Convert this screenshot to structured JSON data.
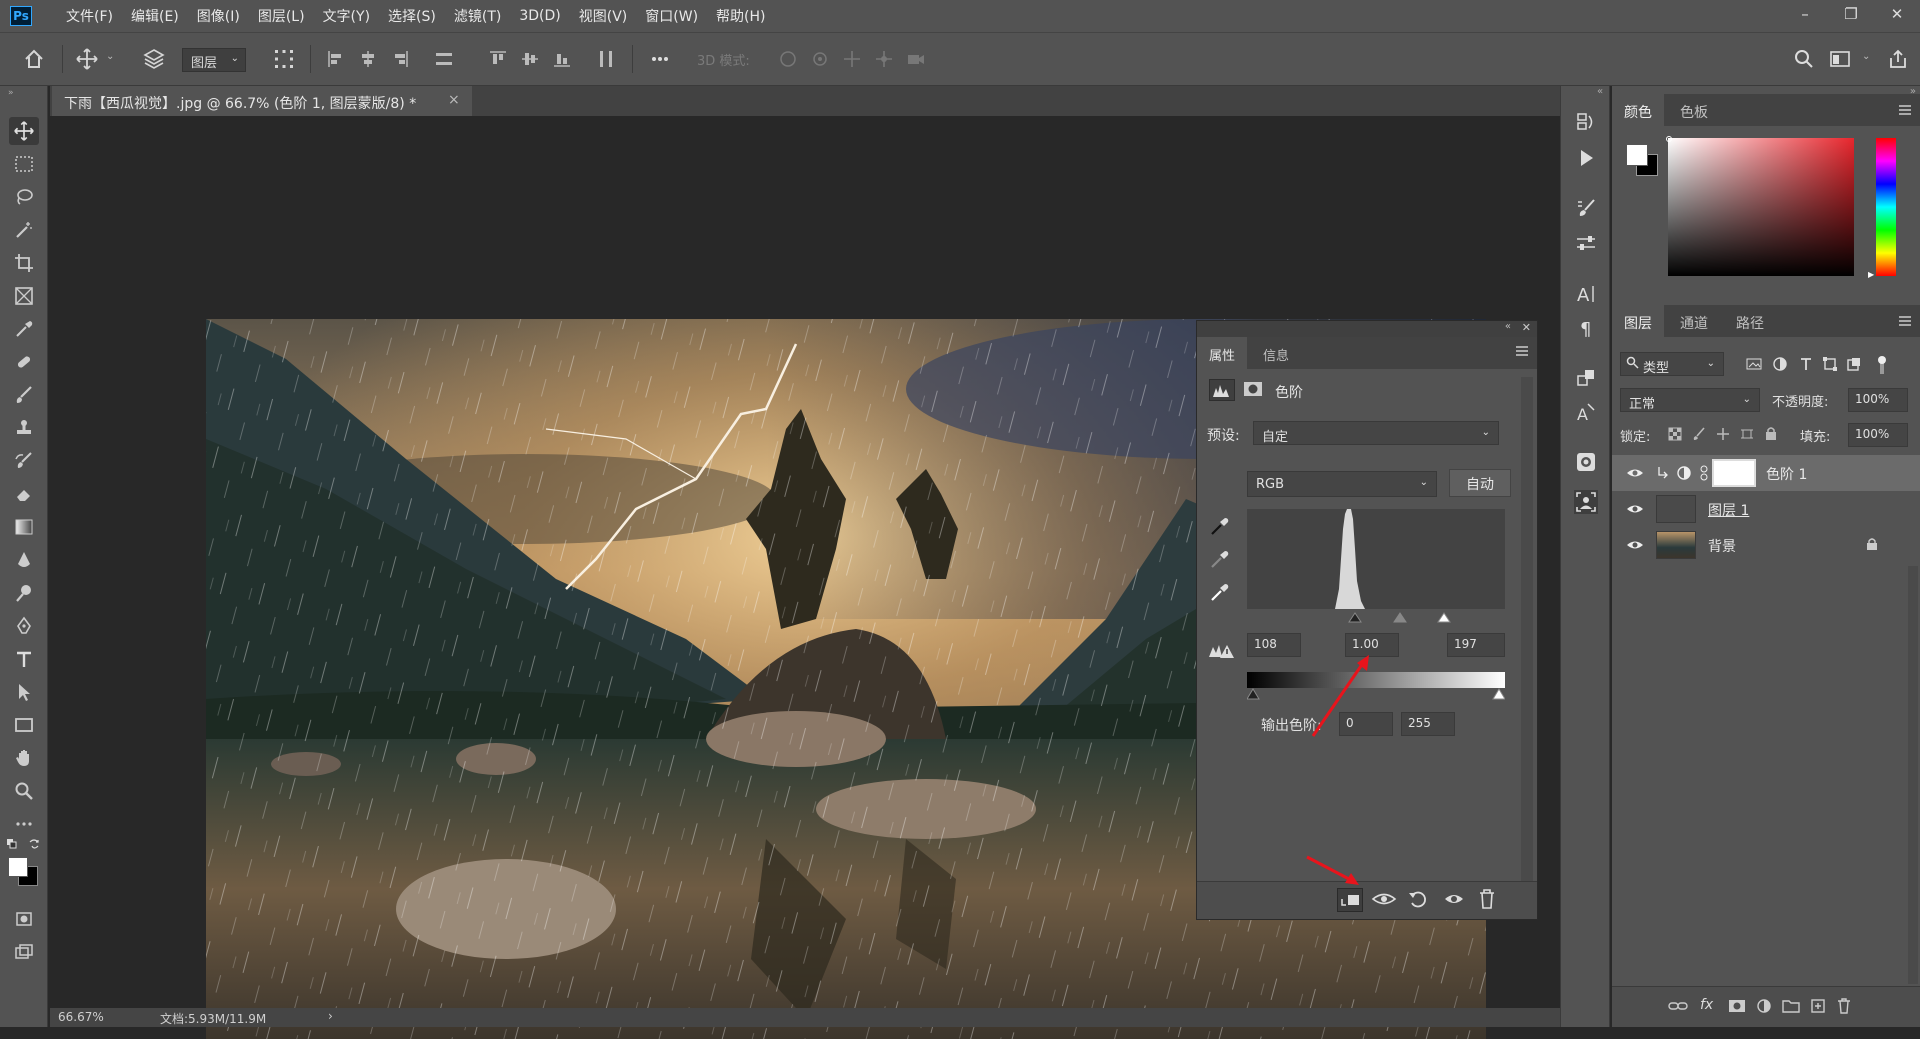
{
  "app": {
    "logo": "Ps"
  },
  "menu": [
    "文件(F)",
    "编辑(E)",
    "图像(I)",
    "图层(L)",
    "文字(Y)",
    "选择(S)",
    "滤镜(T)",
    "3D(D)",
    "视图(V)",
    "窗口(W)",
    "帮助(H)"
  ],
  "window_controls": {
    "minimize": "–",
    "restore": "❐",
    "close": "✕"
  },
  "options_bar": {
    "auto_select_value": "图层",
    "mode_3d_label": "3D 模式:"
  },
  "document": {
    "tab_title": "下雨【西瓜视觉】.jpg @ 66.7% (色阶 1, 图层蒙版/8) *",
    "close": "×"
  },
  "status": {
    "zoom": "66.67%",
    "doc_info": "文档:5.93M/11.9M",
    "arrow": "›"
  },
  "properties": {
    "tabs": [
      "属性",
      "信息"
    ],
    "adjustment_name": "色阶",
    "preset_label": "预设:",
    "preset_value": "自定",
    "channel_value": "RGB",
    "auto_button": "自动",
    "input_black": "108",
    "input_gamma": "1.00",
    "input_white": "197",
    "output_label": "输出色阶:",
    "output_black": "0",
    "output_white": "255"
  },
  "color_panel": {
    "tabs": [
      "颜色",
      "色板"
    ],
    "hue_accent": "#e8262d"
  },
  "layers_panel": {
    "tabs": [
      "图层",
      "通道",
      "路径"
    ],
    "filter_kind": "类型",
    "blend_mode": "正常",
    "opacity_label": "不透明度:",
    "opacity_value": "100%",
    "lock_label": "锁定:",
    "fill_label": "填充:",
    "fill_value": "100%",
    "layers": [
      {
        "name": "色阶 1",
        "selected": true
      },
      {
        "name": "图层 1",
        "selected": false
      },
      {
        "name": "背景",
        "selected": false
      }
    ],
    "bottom_fx": "fx"
  },
  "colors": {
    "ui_dark": "#282828",
    "panel": "#535353",
    "annotation_arrow": "#e8141c"
  }
}
